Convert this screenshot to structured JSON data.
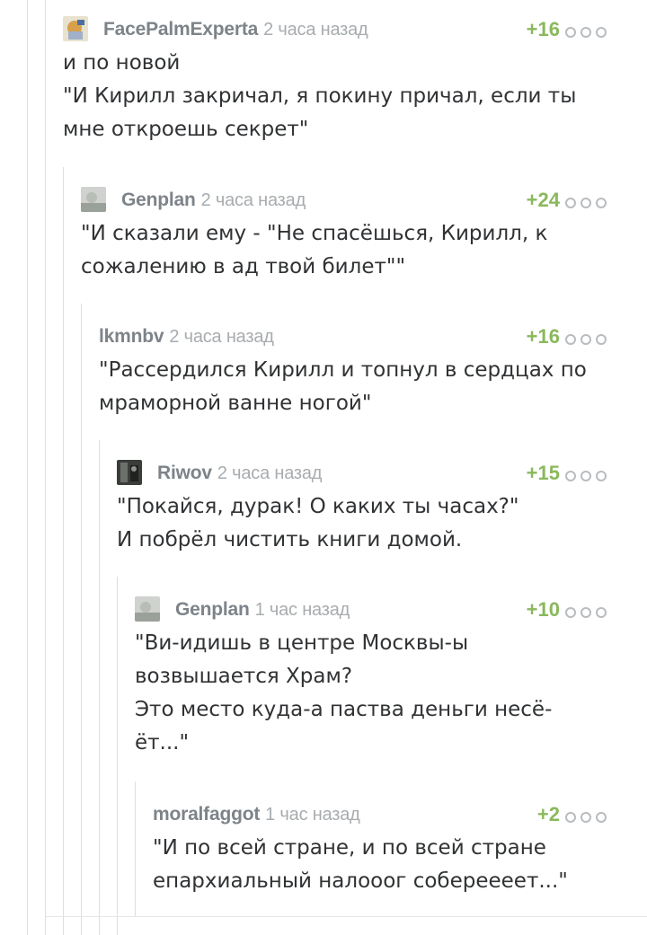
{
  "comments": [
    {
      "author": "FacePalmExperta",
      "time": "2 часа назад",
      "rating": "+16",
      "text": "и по новой\n\"И Кирилл закричал, я покину причал, если ты мне откроешь секрет\""
    },
    {
      "author": "Genplan",
      "time": "2 часа назад",
      "rating": "+24",
      "text": "\"И сказали ему - \"Не спасёшься, Кирилл, к сожалению в ад твой билет\"\""
    },
    {
      "author": "lkmnbv",
      "time": "2 часа назад",
      "rating": "+16",
      "text": "\"Рассердился Кирилл и топнул в сердцах по мраморной ванне ногой\""
    },
    {
      "author": "Riwov",
      "time": "2 часа назад",
      "rating": "+15",
      "text": "\"Покайся, дурак! О каких ты часах?\"\nИ побрёл чистить книги домой."
    },
    {
      "author": "Genplan",
      "time": "1 час назад",
      "rating": "+10",
      "text": "\"Ви-идишь в центре Москвы-ы возвышается Храм?\nЭто место куда-а паства деньги несё-ёт...\""
    },
    {
      "author": "moralfaggot",
      "time": "1 час назад",
      "rating": "+2",
      "text": "\"И по всей стране, и по всей стране епархиальный налооог собереееет...\""
    }
  ],
  "colors": {
    "rating": "#8ab85c",
    "author": "#7d8389",
    "time": "#a8acaf",
    "text": "#303234",
    "thread_line": "#dedede"
  }
}
